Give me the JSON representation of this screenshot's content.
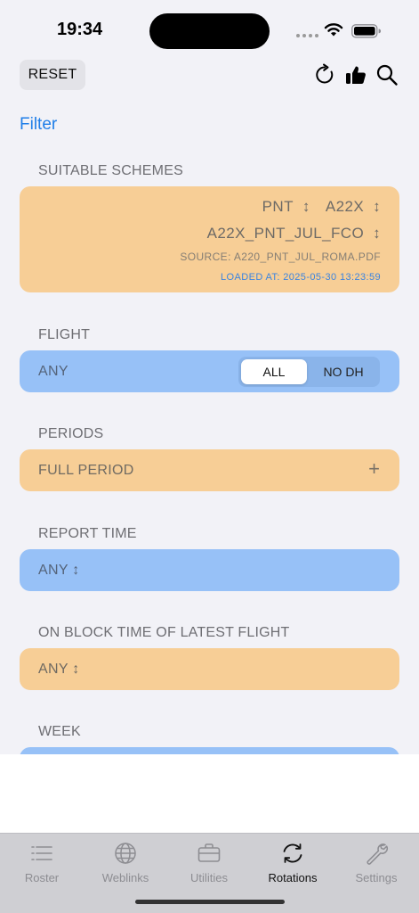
{
  "status": {
    "time": "19:34"
  },
  "toolbar": {
    "reset_label": "RESET",
    "icons": [
      "refresh-icon",
      "thumbs-up-icon",
      "search-icon"
    ]
  },
  "filter_label": "Filter",
  "sections": {
    "schemes": {
      "label": "SUITABLE SCHEMES",
      "rank": "PNT",
      "aircraft": "A22X",
      "scheme": "A22X_PNT_JUL_FCO",
      "source": "SOURCE: A220_PNT_JUL_ROMA.PDF",
      "loaded": "LOADED AT: 2025-05-30 13:23:59",
      "arrow": "↕"
    },
    "flight": {
      "label": "FLIGHT",
      "value": "ANY",
      "options": [
        "ALL",
        "NO DH"
      ],
      "selected": "ALL"
    },
    "periods": {
      "label": "PERIODS",
      "value": "FULL PERIOD",
      "add": "+"
    },
    "report_time": {
      "label": "REPORT TIME",
      "value": "ANY ↕"
    },
    "on_block": {
      "label": "ON BLOCK TIME OF LATEST FLIGHT",
      "value": "ANY ↕"
    },
    "week": {
      "label": "WEEK"
    }
  },
  "tabs": [
    {
      "label": "Roster",
      "icon": "list-icon",
      "active": false
    },
    {
      "label": "Weblinks",
      "icon": "globe-icon",
      "active": false
    },
    {
      "label": "Utilities",
      "icon": "briefcase-icon",
      "active": false
    },
    {
      "label": "Rotations",
      "icon": "rotation-icon",
      "active": true
    },
    {
      "label": "Settings",
      "icon": "wrench-icon",
      "active": false
    }
  ],
  "colors": {
    "accent": "#1f7ee8",
    "orange_card": "#f7ce96",
    "blue_card": "#97c1f7"
  }
}
